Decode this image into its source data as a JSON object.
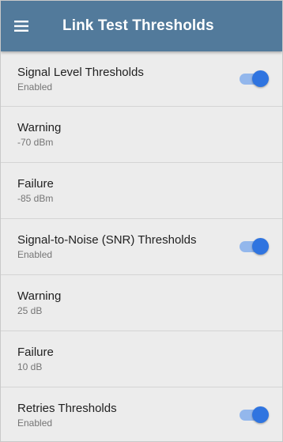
{
  "header": {
    "title": "Link Test Thresholds",
    "menu_icon": "hamburger-menu-icon"
  },
  "colors": {
    "app_bar": "#527a9b",
    "background": "#ececec",
    "toggle_on_thumb": "#2f74e0",
    "toggle_on_track": "#93b7ec"
  },
  "items": [
    {
      "label": "Signal Level Thresholds",
      "value": "Enabled",
      "toggle": true,
      "toggle_on": true
    },
    {
      "label": "Warning",
      "value": "-70 dBm",
      "toggle": false
    },
    {
      "label": "Failure",
      "value": "-85 dBm",
      "toggle": false
    },
    {
      "label": "Signal-to-Noise (SNR) Thresholds",
      "value": "Enabled",
      "toggle": true,
      "toggle_on": true
    },
    {
      "label": "Warning",
      "value": "25 dB",
      "toggle": false
    },
    {
      "label": "Failure",
      "value": "10 dB",
      "toggle": false
    },
    {
      "label": "Retries Thresholds",
      "value": "Enabled",
      "toggle": true,
      "toggle_on": true
    }
  ]
}
